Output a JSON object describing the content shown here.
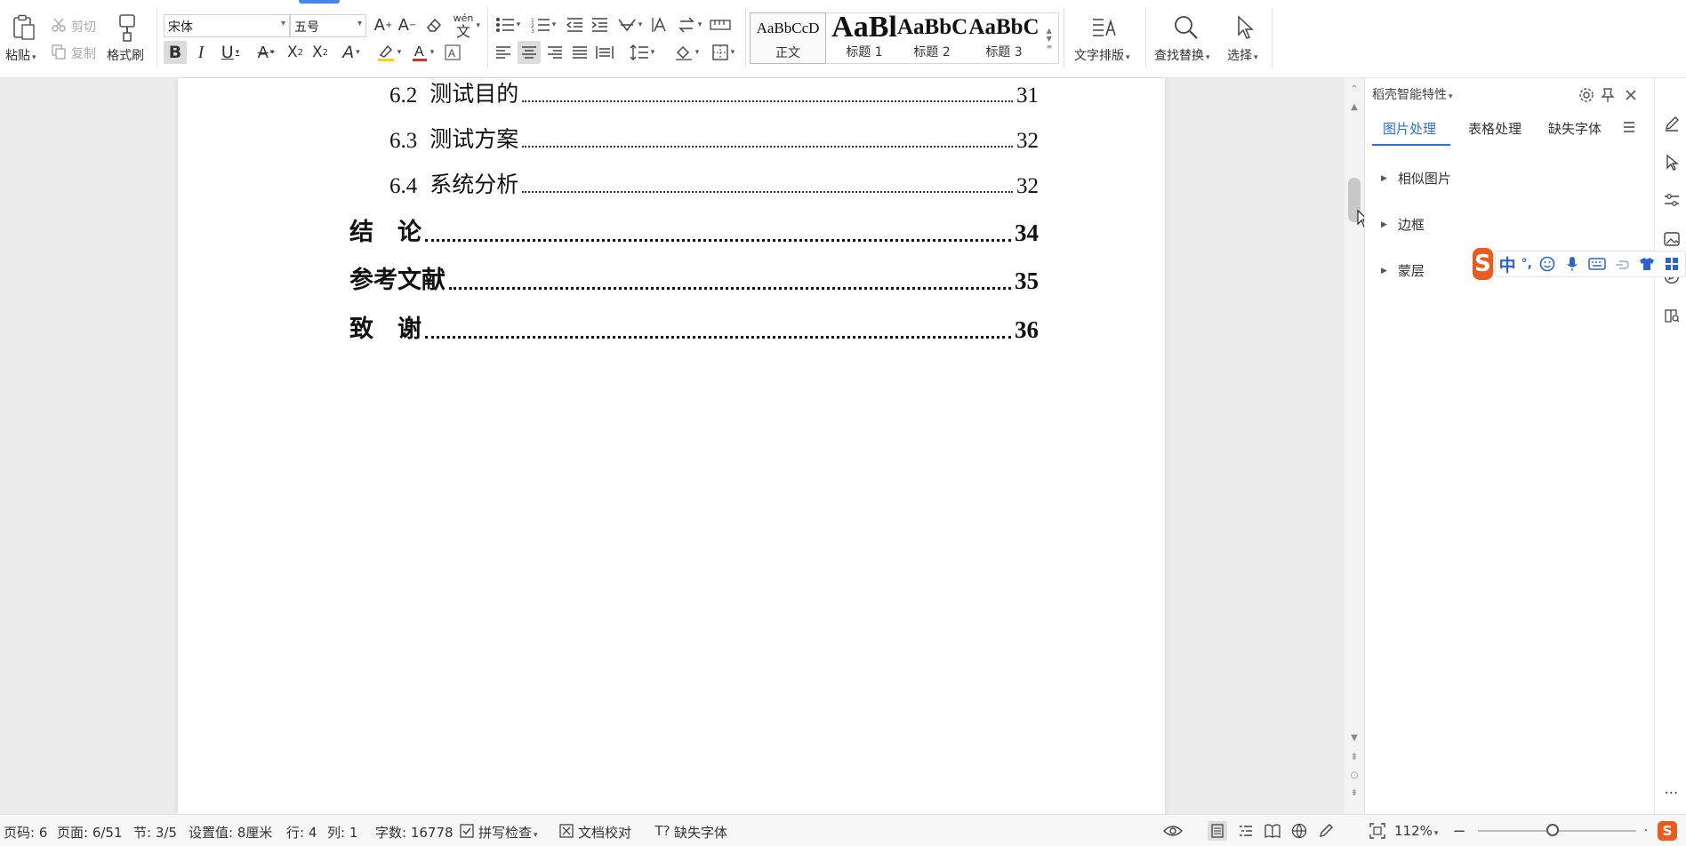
{
  "ribbon": {
    "paste_label": "粘贴",
    "cut_label": "剪切",
    "copy_label": "复制",
    "format_painter_label": "格式刷",
    "font_name": "宋体",
    "font_size": "五号",
    "phonetic_glyph": "wén",
    "styles": [
      {
        "preview": "AaBbCcD",
        "name": "正文"
      },
      {
        "preview": "AaBl",
        "name": "标题 1"
      },
      {
        "preview": "AaBbC",
        "name": "标题 2"
      },
      {
        "preview": "AaBbC",
        "name": "标题 3"
      }
    ],
    "text_layout_label": "文字排版",
    "find_replace_label": "查找替换",
    "select_label": "选择",
    "highlight_color": "#f5d200",
    "font_color": "#d32f2f"
  },
  "document": {
    "toc_entries": [
      {
        "num": "6.2",
        "title": "测试目的",
        "page": "31",
        "level": "sub"
      },
      {
        "num": "6.3",
        "title": "测试方案",
        "page": "32",
        "level": "sub"
      },
      {
        "num": "6.4",
        "title": "系统分析",
        "page": "32",
        "level": "sub"
      },
      {
        "num": "",
        "title": "结　论",
        "page": "34",
        "level": "main"
      },
      {
        "num": "",
        "title": "参考文献",
        "page": "35",
        "level": "main"
      },
      {
        "num": "",
        "title": "致　谢",
        "page": "36",
        "level": "main"
      }
    ]
  },
  "taskpane": {
    "title": "稻壳智能特性",
    "tabs": [
      "图片处理",
      "表格处理",
      "缺失字体"
    ],
    "active_tab": 0,
    "items": [
      "相似图片",
      "边框",
      "蒙层"
    ],
    "accent_color": "#2f6fd6"
  },
  "ime": {
    "logo": "S",
    "mode": "中",
    "punct": "°,"
  },
  "statusbar": {
    "page_code": "页码: 6",
    "page": "页面: 6/51",
    "section": "节: 3/5",
    "setting": "设置值: 8厘米",
    "row": "行: 4",
    "col": "列: 1",
    "word_count": "字数: 16778",
    "spell_check": "拼写检查",
    "doc_check": "文档校对",
    "missing_font": "缺失字体",
    "zoom": "112%"
  }
}
